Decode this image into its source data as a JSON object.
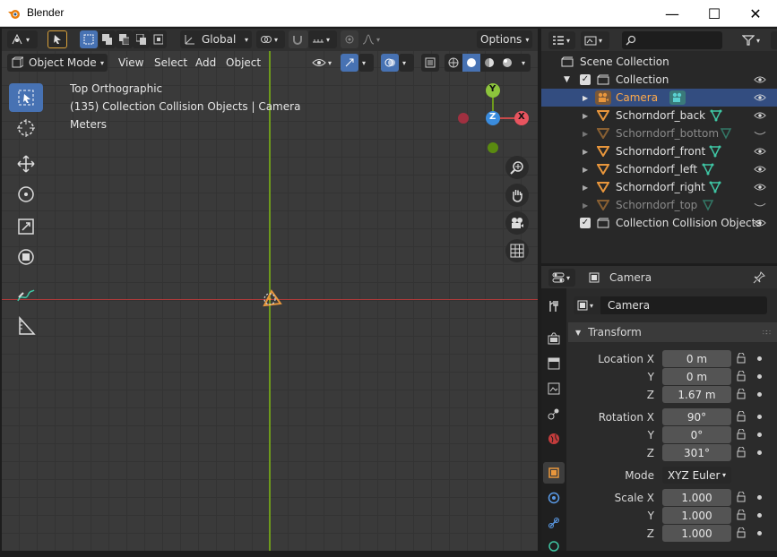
{
  "window": {
    "title": "Blender",
    "minimize": "—",
    "maximize": "☐",
    "close": "✕"
  },
  "viewport": {
    "mode": "Object Mode",
    "menus": [
      "View",
      "Select",
      "Add",
      "Object"
    ],
    "orientation": "Global",
    "options_label": "Options",
    "overlay_lines": [
      "Top Orthographic",
      "(135) Collection Collision Objects | Camera",
      "Meters"
    ],
    "gizmo": {
      "y": "Y",
      "z": "Z",
      "x": "X"
    }
  },
  "outliner": {
    "search_placeholder": "",
    "items": [
      {
        "label": "Scene Collection",
        "type": "scene"
      },
      {
        "label": "Collection",
        "type": "collection"
      },
      {
        "label": "Camera",
        "type": "camera",
        "selected": true
      },
      {
        "label": "Schorndorf_back",
        "type": "mesh"
      },
      {
        "label": "Schorndorf_bottom",
        "type": "mesh",
        "hidden": true
      },
      {
        "label": "Schorndorf_front",
        "type": "mesh"
      },
      {
        "label": "Schorndorf_left",
        "type": "mesh"
      },
      {
        "label": "Schorndorf_right",
        "type": "mesh"
      },
      {
        "label": "Schorndorf_top",
        "type": "mesh",
        "hidden": true
      },
      {
        "label": "Collection Collision Objects",
        "type": "collection"
      }
    ]
  },
  "properties": {
    "header_title": "Camera",
    "object_name": "Camera",
    "panel_title": "Transform",
    "location": {
      "label": "Location X",
      "x": "0 m",
      "y_label": "Y",
      "y": "0 m",
      "z_label": "Z",
      "z": "1.67 m"
    },
    "rotation": {
      "label": "Rotation X",
      "x": "90°",
      "y_label": "Y",
      "y": "0°",
      "z_label": "Z",
      "z": "301°"
    },
    "mode": {
      "label": "Mode",
      "value": "XYZ Euler"
    },
    "scale": {
      "label": "Scale X",
      "x": "1.000",
      "y_label": "Y",
      "y": "1.000",
      "z_label": "Z",
      "z": "1.000"
    }
  },
  "colors": {
    "accent": "#4772b3",
    "selected_row": "#334d80",
    "x_axis": "#c84a4a",
    "y_axis": "#6e9a1c",
    "camera_orange": "#e8963c",
    "mesh_teal": "#3fc6a4"
  }
}
